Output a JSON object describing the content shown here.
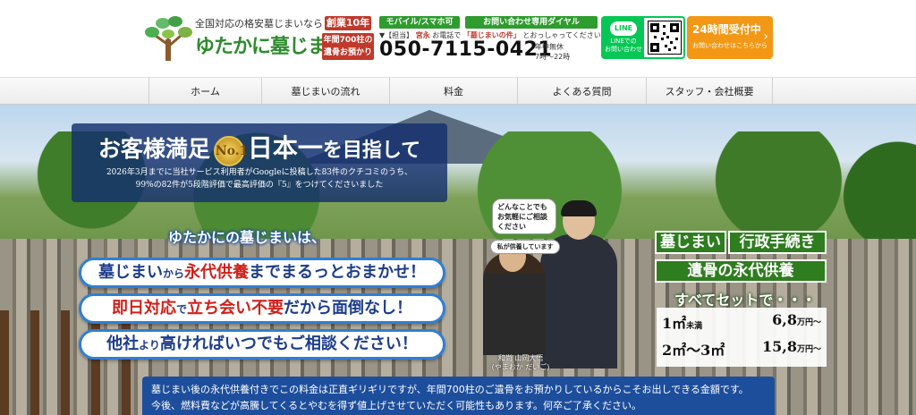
{
  "header": {
    "logo_tagline": "全国対応の格安墓じまいなら",
    "logo_name": "ゆたかに墓じまい",
    "badge_years": "創業10年",
    "badge_remains_line1": "年間700柱の",
    "badge_remains_line2": "遺骨お預かり",
    "phone_label_mobile": "モバイル/スマホ可",
    "phone_label_dedicated": "お問い合わせ専用ダイヤル",
    "phone_note_prefix": "▼【担当】",
    "phone_note_name": "宮永",
    "phone_note_mid": "お電話で",
    "phone_note_highlight": "「墓じまいの件」",
    "phone_note_suffix": "とおっしゃってください！",
    "phone_number": "050-7115-0421",
    "phone_hours_line1": "年中無休",
    "phone_hours_line2": "7時～22時",
    "line_badge": "LINE",
    "line_sub1": "LINEでの",
    "line_sub2": "お問い合わせ",
    "cta_title": "24時間受付中",
    "cta_sub": "お問い合わせはこちらから",
    "cta_arrow": "›"
  },
  "nav": {
    "items": [
      "ホーム",
      "墓じまいの流れ",
      "料金",
      "よくある質問",
      "スタッフ・会社概要"
    ]
  },
  "hero": {
    "sat_title_a": "お客様満足",
    "sat_medal": "No.1",
    "sat_title_b": "日本一",
    "sat_title_c": "を目指して",
    "sat_sub1": "2026年3月までに当社サービス利用者がGoogleに投稿した83件のクチコミのうち、",
    "sat_sub2": "99%の82件が5段階評価で最高評価の『5』をつけてくださいました",
    "yutakani": "ゆたかにの墓じまいは、",
    "pills": [
      {
        "a": "墓じまい",
        "b": "から",
        "c": "永代供養",
        "d": "までまるっとおまかせ！"
      },
      {
        "a": "即日対応",
        "b": "で",
        "c": "立ち会い不要",
        "d": "だから面倒なし！"
      },
      {
        "a": "他社",
        "b": "より",
        "c": "高ければいつでもご相談ください！",
        "d": ""
      }
    ],
    "bubble1": "どんなことでもお気軽にご相談ください",
    "bubble2": "私が供養しています",
    "priest_name": "和尚 山岡大悟",
    "priest_reading": "(やまおか だいご)",
    "svc_grave": "墓じまい",
    "svc_admin": "行政手続き",
    "svc_eternal": "遺骨の永代供養",
    "set_label": "すべてセットで・・・",
    "price1_label": "1㎡",
    "price1_label_s": "未満",
    "price1_value": "6,8",
    "price1_unit": "万円〜",
    "price2_label": "2㎡〜3㎡",
    "price2_value": "15,8",
    "price2_unit": "万円〜"
  },
  "notice": {
    "line1": "墓じまい後の永代供養付きでこの料金は正直ギリギリですが、年間700柱のご遺骨をお預かりしているからこそお出しできる金額です。",
    "line2": "今後、燃料費などが高騰してくるとやむを得ず値上げさせていただく可能性もあります。何卒ご了承ください。"
  }
}
